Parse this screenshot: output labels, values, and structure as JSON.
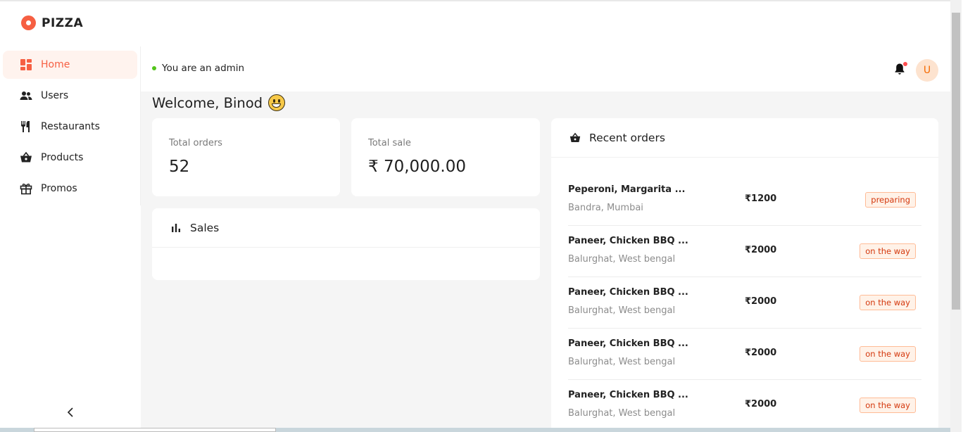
{
  "brand": {
    "name": "PIZZA",
    "accent": "#f65f42"
  },
  "sidebar": {
    "items": [
      {
        "label": "Home",
        "icon": "dashboard-icon",
        "active": true
      },
      {
        "label": "Users",
        "icon": "users-icon",
        "active": false
      },
      {
        "label": "Restaurants",
        "icon": "fork-knife-icon",
        "active": false
      },
      {
        "label": "Products",
        "icon": "basket-icon",
        "active": false
      },
      {
        "label": "Promos",
        "icon": "gift-icon",
        "active": false
      }
    ],
    "collapse_icon": "chevron-left-icon"
  },
  "header": {
    "status_text": "You are an admin",
    "status_color": "#52c41a",
    "avatar_initial": "U",
    "notification_icon": "bell-icon"
  },
  "main": {
    "welcome": "Welcome, Binod",
    "stats": [
      {
        "label": "Total orders",
        "value": "52"
      },
      {
        "label": "Total sale",
        "value": "₹ 70,000.00"
      }
    ],
    "sales_title": "Sales",
    "recent_orders": {
      "title": "Recent orders",
      "orders": [
        {
          "items": "Peperoni, Margarita ...",
          "address": "Bandra, Mumbai",
          "amount": "₹1200",
          "status": "preparing"
        },
        {
          "items": "Paneer, Chicken BBQ ...",
          "address": "Balurghat, West bengal",
          "amount": "₹2000",
          "status": "on the way"
        },
        {
          "items": "Paneer, Chicken BBQ ...",
          "address": "Balurghat, West bengal",
          "amount": "₹2000",
          "status": "on the way"
        },
        {
          "items": "Paneer, Chicken BBQ ...",
          "address": "Balurghat, West bengal",
          "amount": "₹2000",
          "status": "on the way"
        },
        {
          "items": "Paneer, Chicken BBQ ...",
          "address": "Balurghat, West bengal",
          "amount": "₹2000",
          "status": "on the way"
        }
      ]
    }
  }
}
